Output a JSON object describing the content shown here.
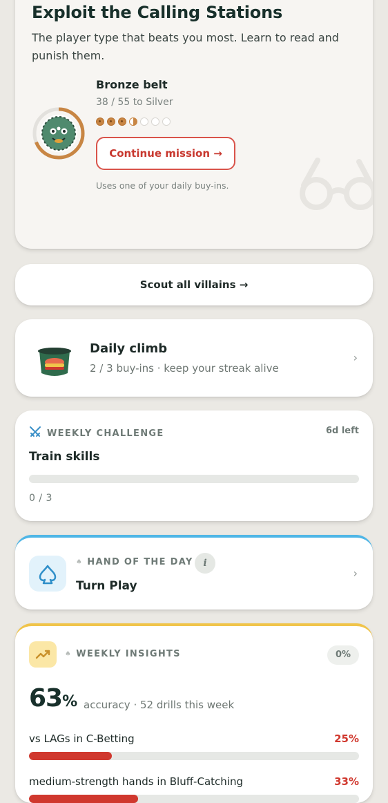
{
  "mission": {
    "title": "Exploit the Calling Stations",
    "description": "The player type that beats you most. Learn to read and punish them.",
    "belt": "Bronze belt",
    "progress_text": "38 / 55 to Silver",
    "progress_fraction": 0.69,
    "pips": [
      "full",
      "full",
      "full",
      "half",
      "empty",
      "empty",
      "empty"
    ],
    "continue_label": "Continue mission →",
    "note": "Uses one of your daily buy-ins."
  },
  "scout": {
    "label": "Scout all villains →"
  },
  "daily_climb": {
    "title": "Daily climb",
    "subtitle": "2 / 3 buy-ins · keep your streak alive",
    "chevron": "›"
  },
  "weekly_challenge": {
    "label": "WEEKLY CHALLENGE",
    "time_left": "6d left",
    "title": "Train skills",
    "progress_fraction": 0,
    "count": "0 / 3"
  },
  "hand_of_day": {
    "label": "HAND OF THE DAY",
    "info": "i",
    "title": "Turn Play",
    "chevron": "›"
  },
  "weekly_insights": {
    "label": "WEEKLY INSIGHTS",
    "badge": "0%",
    "accuracy_value": "63",
    "accuracy_unit": "%",
    "accuracy_sub": "accuracy · 52 drills this week",
    "rows": [
      {
        "label": "vs LAGs in C-Betting",
        "value": "25%",
        "fraction": 0.25
      },
      {
        "label": "medium-strength hands in Bluff-Catching",
        "value": "33%",
        "fraction": 0.33
      }
    ]
  },
  "colors": {
    "accent_red": "#d0382e",
    "bronze": "#c88644",
    "sky": "#4fb6e6",
    "gold": "#f0c44a"
  }
}
